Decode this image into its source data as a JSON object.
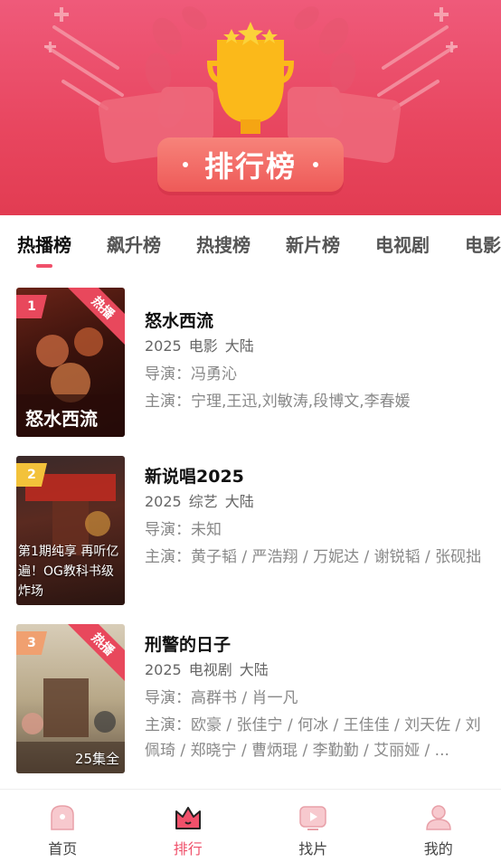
{
  "banner": {
    "title": "排行榜"
  },
  "tabs": [
    {
      "label": "热播榜",
      "active": true
    },
    {
      "label": "飙升榜",
      "active": false
    },
    {
      "label": "热搜榜",
      "active": false
    },
    {
      "label": "新片榜",
      "active": false
    },
    {
      "label": "电视剧",
      "active": false
    },
    {
      "label": "电影",
      "active": false
    }
  ],
  "items": [
    {
      "rank": "1",
      "badge": "热播",
      "title": "怒水西流",
      "year": "2025",
      "type": "电影",
      "region": "大陆",
      "director": "导演：冯勇沁",
      "actors": "主演：宁理,王迅,刘敏涛,段博文,李春媛",
      "rank_color": "#e8485c",
      "poster_caption": "",
      "poster_episode": ""
    },
    {
      "rank": "2",
      "badge": "",
      "title": "新说唱2025",
      "year": "2025",
      "type": "综艺",
      "region": "大陆",
      "director": "导演：未知",
      "actors": "主演：黄子韬 / 严浩翔 / 万妮达 / 谢锐韬 / 张砚拙",
      "rank_color": "#f3c23a",
      "poster_caption": "第1期纯享 再听亿遍！OG教科书级炸场",
      "poster_episode": ""
    },
    {
      "rank": "3",
      "badge": "热播",
      "title": "刑警的日子",
      "year": "2025",
      "type": "电视剧",
      "region": "大陆",
      "director": "导演：高群书 / 肖一凡",
      "actors": "主演：欧豪 / 张佳宁 / 何冰 / 王佳佳 / 刘天佐 / 刘佩琦 / 郑晓宁 / 曹炳琨 / 李勤勤 / 艾丽娅 / ...",
      "rank_color": "#f0a070",
      "poster_caption": "",
      "poster_episode": "25集全"
    }
  ],
  "nav": [
    {
      "label": "首页",
      "icon": "home-icon",
      "active": false
    },
    {
      "label": "排行",
      "icon": "crown-icon",
      "active": true
    },
    {
      "label": "找片",
      "icon": "tv-play-icon",
      "active": false
    },
    {
      "label": "我的",
      "icon": "user-icon",
      "active": false
    }
  ],
  "colors": {
    "accent": "#f0506a",
    "banner": "#e8465f",
    "trophy": "#fbb91a"
  }
}
